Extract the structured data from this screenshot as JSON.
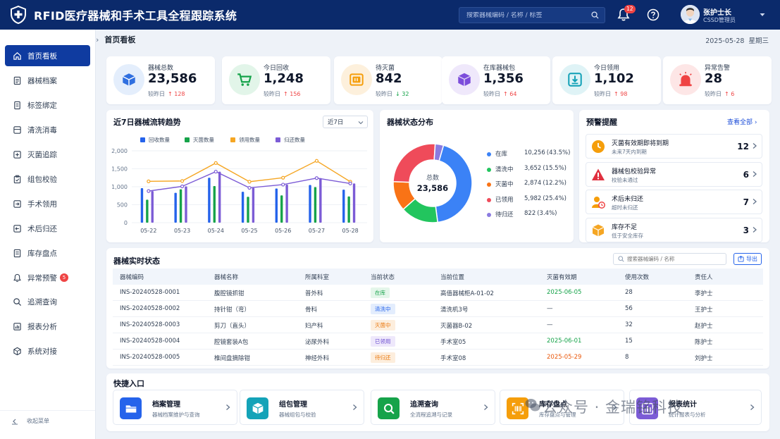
{
  "header": {
    "title": "RFID医疗器械和手术工具全程跟踪系统",
    "search_placeholder": "搜索器械编码 / 名称 / 标签",
    "notification_count": "12",
    "user_name": "张护士长",
    "user_role": "CSSD管理员"
  },
  "sidebar": {
    "items": [
      {
        "label": "首页看板",
        "icon": "home-icon"
      },
      {
        "label": "器械档案",
        "icon": "archive-icon"
      },
      {
        "label": "标签绑定",
        "icon": "tag-icon"
      },
      {
        "label": "清洗消毒",
        "icon": "wash-icon"
      },
      {
        "label": "灭菌追踪",
        "icon": "sterilize-icon"
      },
      {
        "label": "组包校验",
        "icon": "package-check-icon"
      },
      {
        "label": "手术领用",
        "icon": "checkout-icon"
      },
      {
        "label": "术后归还",
        "icon": "return-icon"
      },
      {
        "label": "库存盘点",
        "icon": "inventory-icon"
      },
      {
        "label": "异常预警",
        "icon": "bell-icon",
        "badge": "5"
      },
      {
        "label": "追溯查询",
        "icon": "search-icon"
      },
      {
        "label": "报表分析",
        "icon": "report-icon"
      },
      {
        "label": "系统对接",
        "icon": "integration-icon"
      }
    ],
    "collapse_label": "收起菜单"
  },
  "breadcrumb": {
    "current": "首页看板",
    "date": "2025-05-28",
    "weekday": "星期三"
  },
  "stats": [
    {
      "label": "器械总数",
      "value": "23,586",
      "delta_prefix": "较昨日",
      "delta": "↑ 128",
      "trend": "up",
      "color": "#2f6fe0",
      "bg": "#e4eefc",
      "icon": "box-icon"
    },
    {
      "label": "今日回收",
      "value": "1,248",
      "delta_prefix": "较昨日",
      "delta": "↑ 156",
      "trend": "up",
      "color": "#16a34a",
      "bg": "#e2f5e9",
      "icon": "cart-icon"
    },
    {
      "label": "待灭菌",
      "value": "842",
      "delta_prefix": "较昨日",
      "delta": "↓ 32",
      "trend": "down",
      "color": "#f59e0b",
      "bg": "#fdf0dc",
      "icon": "sterilizer-icon"
    },
    {
      "label": "在库器械包",
      "value": "1,356",
      "delta_prefix": "较昨日",
      "delta": "↑ 64",
      "trend": "up",
      "color": "#7c4ddb",
      "bg": "#efe8fb",
      "icon": "cube-icon"
    },
    {
      "label": "今日领用",
      "value": "1,102",
      "delta_prefix": "较昨日",
      "delta": "↑ 98",
      "trend": "up",
      "color": "#0e9fb5",
      "bg": "#dff3f6",
      "icon": "download-icon"
    },
    {
      "label": "异常告警",
      "value": "28",
      "delta_prefix": "较昨日",
      "delta": "↑ 6",
      "trend": "up",
      "color": "#ef4444",
      "bg": "#fde6e6",
      "icon": "alarm-icon"
    }
  ],
  "trend_panel": {
    "title": "近7日器械流转趋势",
    "range_select": "近7日"
  },
  "chart_data": {
    "type": "bar",
    "categories": [
      "05-22",
      "05-23",
      "05-24",
      "05-25",
      "05-26",
      "05-27",
      "05-28"
    ],
    "series": [
      {
        "name": "回收数量",
        "type": "bar",
        "color": "#2563eb",
        "values": [
          960,
          830,
          1250,
          860,
          950,
          1050,
          920
        ]
      },
      {
        "name": "灭菌数量",
        "type": "bar",
        "color": "#16a34a",
        "values": [
          640,
          930,
          1020,
          720,
          760,
          990,
          730
        ]
      },
      {
        "name": "领用数量",
        "type": "line",
        "color": "#f5a623",
        "values": [
          1150,
          1160,
          1660,
          1140,
          1250,
          1720,
          1140
        ]
      },
      {
        "name": "归还数量",
        "type": "bar+line",
        "color": "#7c5cd6",
        "values": [
          880,
          1010,
          1420,
          970,
          1060,
          1240,
          1090
        ]
      }
    ],
    "ylim": [
      0,
      2000
    ],
    "yticks": [
      "0",
      "500",
      "1,000",
      "1,500",
      "2,000"
    ],
    "legend_position": "top",
    "grid": true
  },
  "status_panel": {
    "title": "器械状态分布",
    "center_label": "总数",
    "center_value": "23,586",
    "slices": [
      {
        "name": "在库",
        "value": "10,256",
        "pct": "(43.5%)",
        "num": 43.5,
        "color": "#3b82f6"
      },
      {
        "name": "清洗中",
        "value": "3,652",
        "pct": "(15.5%)",
        "num": 15.5,
        "color": "#22c55e"
      },
      {
        "name": "灭菌中",
        "value": "2,874",
        "pct": "(12.2%)",
        "num": 12.2,
        "color": "#f97316"
      },
      {
        "name": "已领用",
        "value": "5,982",
        "pct": "(25.4%)",
        "num": 25.4,
        "color": "#ef4b5a"
      },
      {
        "name": "待归还",
        "value": "822",
        "pct": "(3.4%)",
        "num": 3.4,
        "color": "#8b7be0"
      }
    ]
  },
  "alerts_panel": {
    "title": "预警提醒",
    "view_all": "查看全部 ›",
    "items": [
      {
        "title": "灭菌有效期即将到期",
        "sub": "未来7天内到期",
        "count": "12",
        "icon": "clock-icon"
      },
      {
        "title": "器械包校验异常",
        "sub": "校验未通过",
        "count": "6",
        "icon": "warning-icon"
      },
      {
        "title": "术后未归还",
        "sub": "超时未归还",
        "count": "7",
        "icon": "user-clock-icon"
      },
      {
        "title": "库存不足",
        "sub": "低于安全库存",
        "count": "3",
        "icon": "package-icon"
      }
    ]
  },
  "table": {
    "title": "器械实时状态",
    "search_placeholder": "搜索器械编码 / 名称",
    "export_label": "导出",
    "columns": [
      "器械编码",
      "器械名称",
      "所属科室",
      "当前状态",
      "当前位置",
      "灭菌有效期",
      "使用次数",
      "责任人"
    ],
    "rows": [
      {
        "code": "INS-20240528-0001",
        "name": "腹腔镜抓钳",
        "dept": "普外科",
        "status": "在库",
        "status_color": "#16a34a",
        "status_bg": "#e4f6ea",
        "location": "高值器械柜A-01-02",
        "expiry": "2025-06-05",
        "expiry_color": "#16a34a",
        "uses": "28",
        "owner": "李护士"
      },
      {
        "code": "INS-20240528-0002",
        "name": "持针钳（弯）",
        "dept": "骨科",
        "status": "清洗中",
        "status_color": "#2563eb",
        "status_bg": "#e3edfd",
        "location": "清洗机3号",
        "expiry": "—",
        "expiry_color": "#334155",
        "uses": "56",
        "owner": "王护士"
      },
      {
        "code": "INS-20240528-0003",
        "name": "剪刀（直头）",
        "dept": "妇产科",
        "status": "灭菌中",
        "status_color": "#ea7a12",
        "status_bg": "#fdeedd",
        "location": "灭菌器B-02",
        "expiry": "—",
        "expiry_color": "#334155",
        "uses": "32",
        "owner": "赵护士"
      },
      {
        "code": "INS-20240528-0004",
        "name": "腔镜套装A包",
        "dept": "泌尿外科",
        "status": "已领用",
        "status_color": "#6d4fd1",
        "status_bg": "#eee8fb",
        "location": "手术室05",
        "expiry": "2025-06-01",
        "expiry_color": "#16a34a",
        "uses": "15",
        "owner": "陈护士"
      },
      {
        "code": "INS-20240528-0005",
        "name": "椎间盘摘除钳",
        "dept": "神经外科",
        "status": "待归还",
        "status_color": "#ea7a12",
        "status_bg": "#fdeedd",
        "location": "手术室08",
        "expiry": "2025-05-29",
        "expiry_color": "#ea580c",
        "uses": "8",
        "owner": "刘护士"
      }
    ]
  },
  "quick": {
    "title": "快捷入口",
    "items": [
      {
        "title": "档案管理",
        "sub": "器械档案维护与查询",
        "color": "#2563eb",
        "icon": "folder-icon"
      },
      {
        "title": "组包管理",
        "sub": "器械组包与校验",
        "color": "#14a3b8",
        "icon": "cube-icon"
      },
      {
        "title": "追溯查询",
        "sub": "全流程追溯与记录",
        "color": "#16a34a",
        "icon": "search-icon"
      },
      {
        "title": "库存盘点",
        "sub": "库存盘点与管理",
        "color": "#f59e0b",
        "icon": "rfid-scan-icon"
      },
      {
        "title": "报表统计",
        "sub": "统计报表与分析",
        "color": "#7c5cd6",
        "icon": "chart-icon"
      }
    ]
  },
  "watermark": "公众号 · 金瑞铭科技"
}
